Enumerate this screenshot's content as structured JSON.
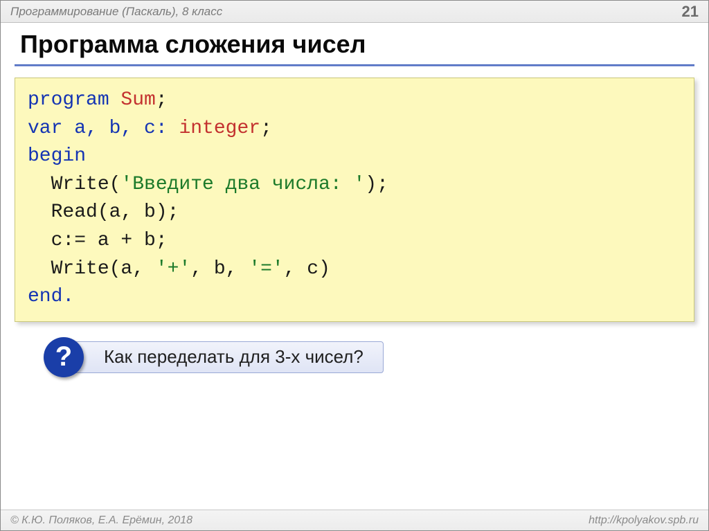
{
  "header": {
    "course": "Программирование (Паскаль), 8 класс",
    "page_number": "21"
  },
  "title": "Программа сложения чисел",
  "code": {
    "l1_a": "program ",
    "l1_sum": "Sum",
    "l1_b": ";",
    "l2_a": "var a, b, c: ",
    "l2_type": "integer",
    "l2_b": ";",
    "l3": "begin",
    "l4_a": "  Write(",
    "l4_str": "'Введите два числа: '",
    "l4_b": ");",
    "l5": "  Read(a, b);",
    "l6": "  c:= a + b;",
    "l7_a": "  Write(a, ",
    "l7_s1": "'+'",
    "l7_b": ", b, ",
    "l7_s2": "'='",
    "l7_c": ", c)",
    "l8": "end."
  },
  "callout": {
    "icon": "?",
    "text": "Как переделать для 3-х чисел?"
  },
  "footer": {
    "copyright": "© К.Ю. Поляков, Е.А. Ерёмин, 2018",
    "url": "http://kpolyakov.spb.ru"
  }
}
